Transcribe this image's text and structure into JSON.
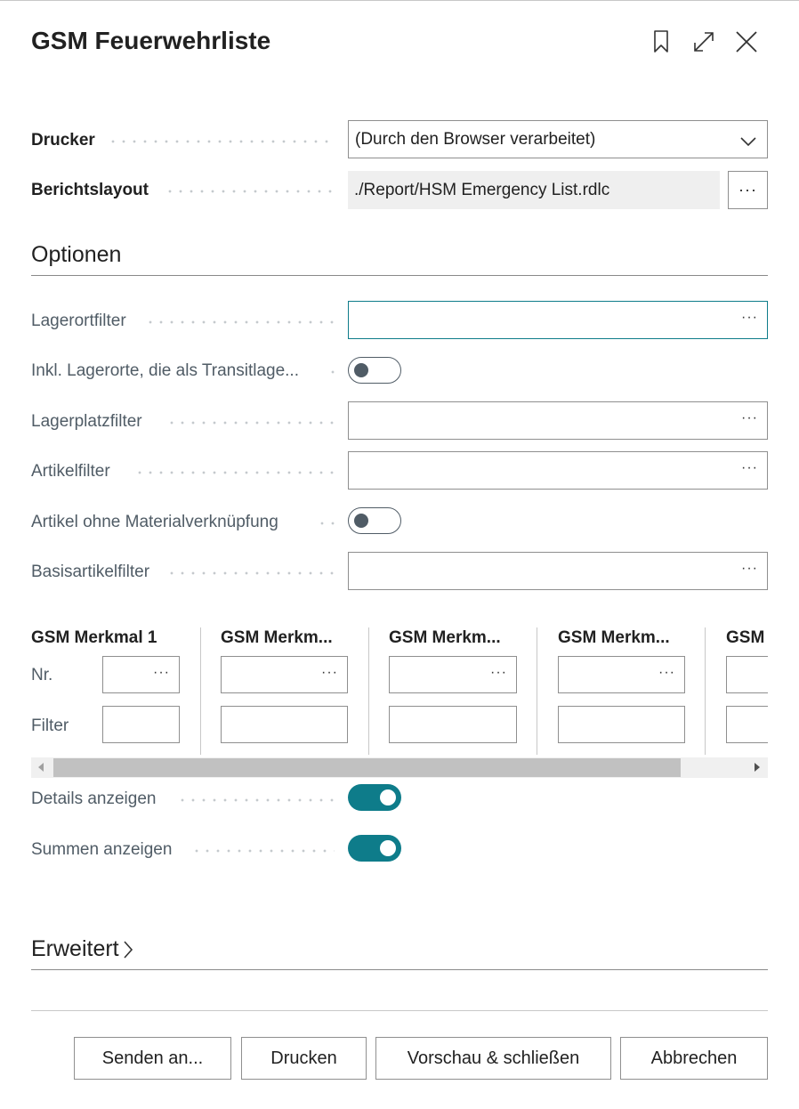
{
  "dialog": {
    "title": "GSM Feuerwehrliste",
    "header_icons": [
      "bookmark-icon",
      "expand-icon",
      "close-icon"
    ]
  },
  "printer": {
    "label": "Drucker",
    "value": "(Durch den Browser verarbeitet)"
  },
  "layout": {
    "label": "Berichtslayout",
    "value": "./Report/HSM Emergency List.rdlc",
    "button": "···"
  },
  "options": {
    "heading": "Optionen",
    "location_filter": {
      "label": "Lagerortfilter",
      "value": ""
    },
    "incl_transit": {
      "label": "Inkl. Lagerorte, die als Transitlage...",
      "on": false
    },
    "bin_filter": {
      "label": "Lagerplatzfilter",
      "value": ""
    },
    "item_filter": {
      "label": "Artikelfilter",
      "value": ""
    },
    "no_material_link": {
      "label": "Artikel ohne Materialverknüpfung",
      "on": false
    },
    "base_item_filter": {
      "label": "Basisartikelfilter",
      "value": ""
    },
    "grid": {
      "row_labels": {
        "nr": "Nr.",
        "filter": "Filter"
      },
      "columns": [
        {
          "header": "GSM Merkmal 1"
        },
        {
          "header": "GSM Merkm..."
        },
        {
          "header": "GSM Merkm..."
        },
        {
          "header": "GSM Merkm..."
        },
        {
          "header": "GSM"
        }
      ],
      "ellipsis": "···"
    },
    "show_details": {
      "label": "Details anzeigen",
      "on": true
    },
    "show_totals": {
      "label": "Summen anzeigen",
      "on": true
    }
  },
  "advanced": {
    "heading": "Erweitert"
  },
  "buttons": {
    "send": "Senden an...",
    "print": "Drucken",
    "preview_close": "Vorschau & schließen",
    "cancel": "Abbrechen"
  },
  "colors": {
    "accent": "#0e7c8a",
    "muted_text": "#505c66"
  }
}
